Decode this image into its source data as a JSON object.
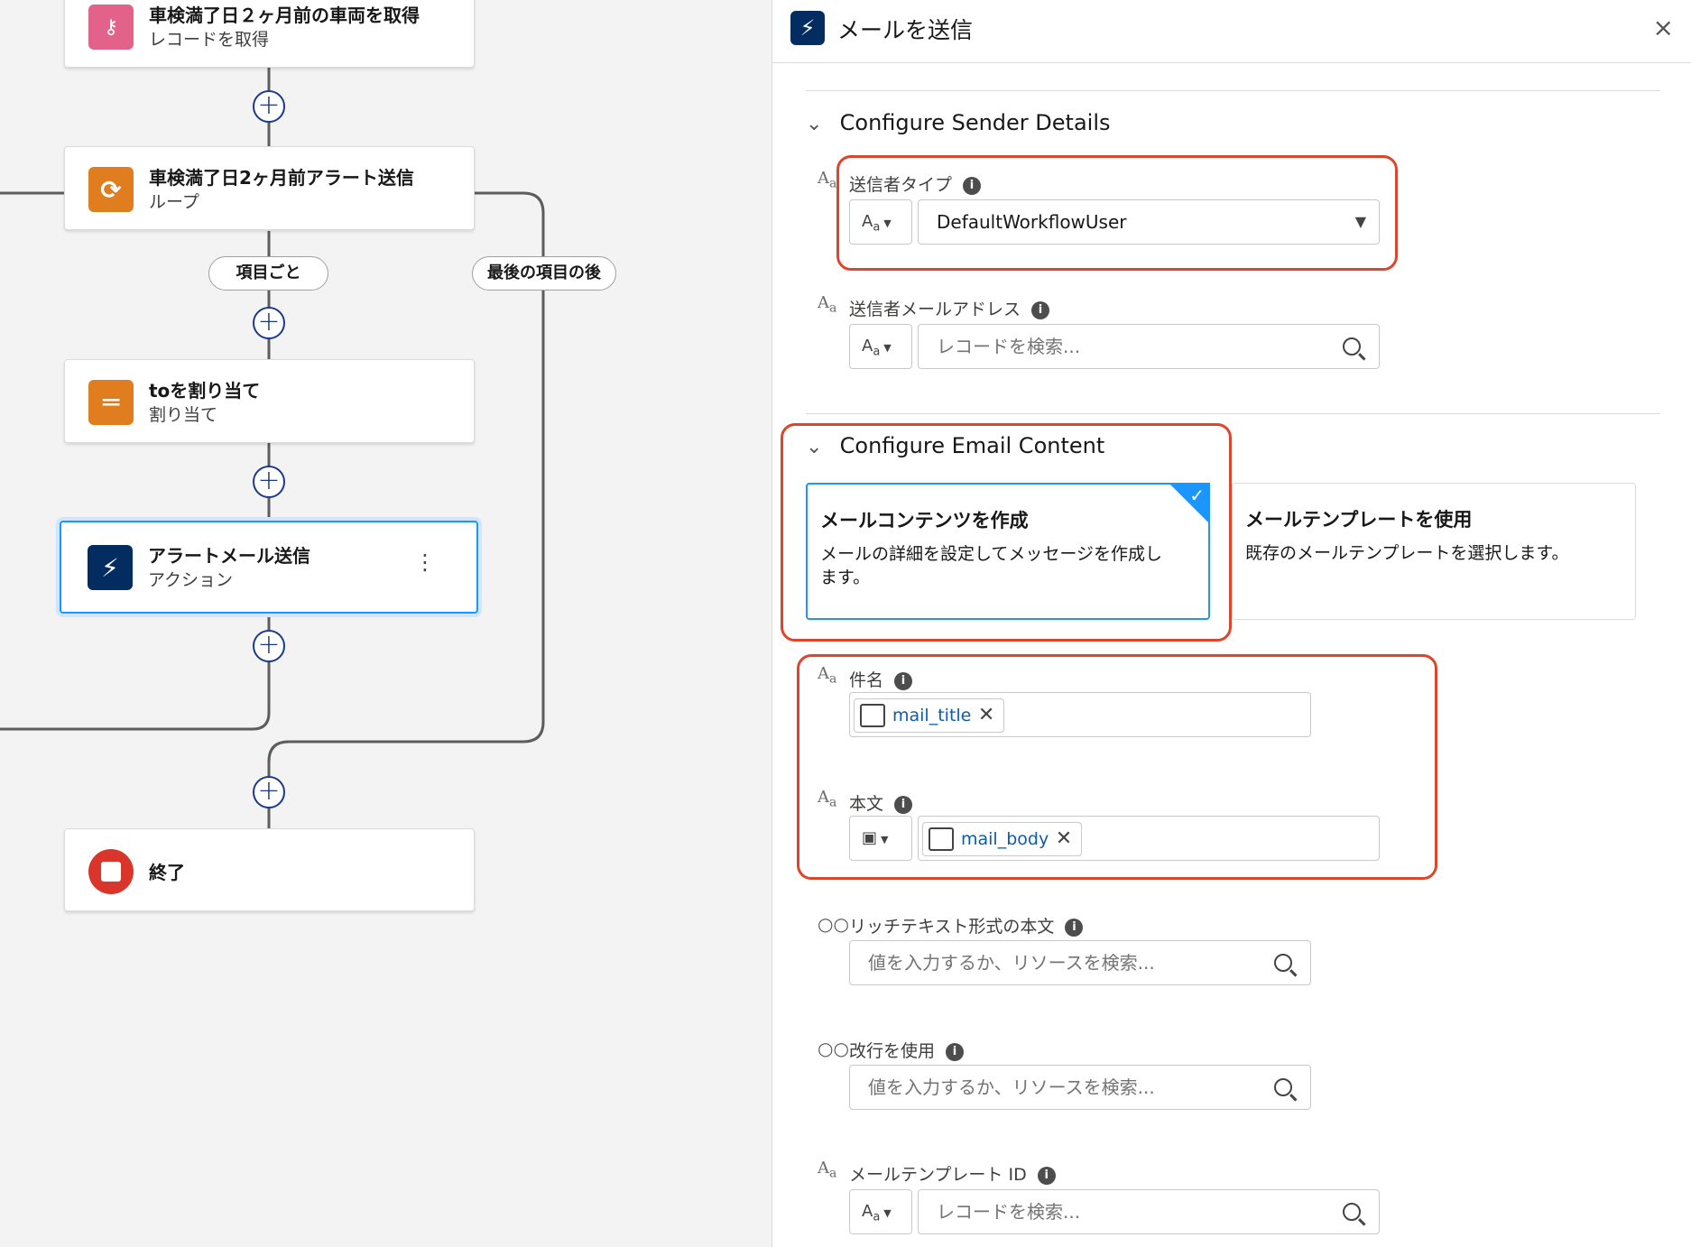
{
  "canvas": {
    "nodes": [
      {
        "title": "車検満了日２ヶ月前の車両を取得",
        "subtitle": "レコードを取得",
        "icon": "search-record-icon",
        "color": "#e3628a"
      },
      {
        "title": "車検満了日2ヶ月前アラート送信",
        "subtitle": "ループ",
        "icon": "loop-icon",
        "color": "#e07d1f"
      },
      {
        "title": "toを割り当て",
        "subtitle": "割り当て",
        "icon": "assignment-icon",
        "color": "#e07d1f"
      },
      {
        "title": "アラートメール送信",
        "subtitle": "アクション",
        "icon": "lightning-icon",
        "color": "#032d60"
      },
      {
        "title": "終了",
        "icon": "stop-icon",
        "color": "#d9352b"
      }
    ],
    "loop_labels": {
      "for_each": "項目ごと",
      "after_last": "最後の項目の後"
    }
  },
  "panel": {
    "title": "メールを送信",
    "close": "×",
    "sender_section": {
      "title": "Configure Sender Details",
      "sender_type_label": "送信者タイプ",
      "sender_type_value": "DefaultWorkflowUser",
      "sender_address_label": "送信者メールアドレス",
      "sender_address_placeholder": "レコードを検索..."
    },
    "content_section": {
      "title": "Configure Email Content",
      "cards": [
        {
          "title": "メールコンテンツを作成",
          "desc": "メールの詳細を設定してメッセージを作成します。",
          "selected": true
        },
        {
          "title": "メールテンプレートを使用",
          "desc": "既存のメールテンプレートを選択します。",
          "selected": false
        }
      ],
      "subject_label": "件名",
      "subject_value": "mail_title",
      "body_label": "本文",
      "body_value": "mail_body",
      "rich_text_label": "リッチテキスト形式の本文",
      "rich_text_placeholder": "値を入力するか、リソースを検索...",
      "line_break_label": "改行を使用",
      "line_break_placeholder": "値を入力するか、リソースを検索...",
      "template_id_label": "メールテンプレート ID",
      "template_id_placeholder": "レコードを検索..."
    }
  },
  "colors": {
    "accent": "#1b96ff",
    "highlight": "#e0442a",
    "connector": "#5c5c5c"
  }
}
